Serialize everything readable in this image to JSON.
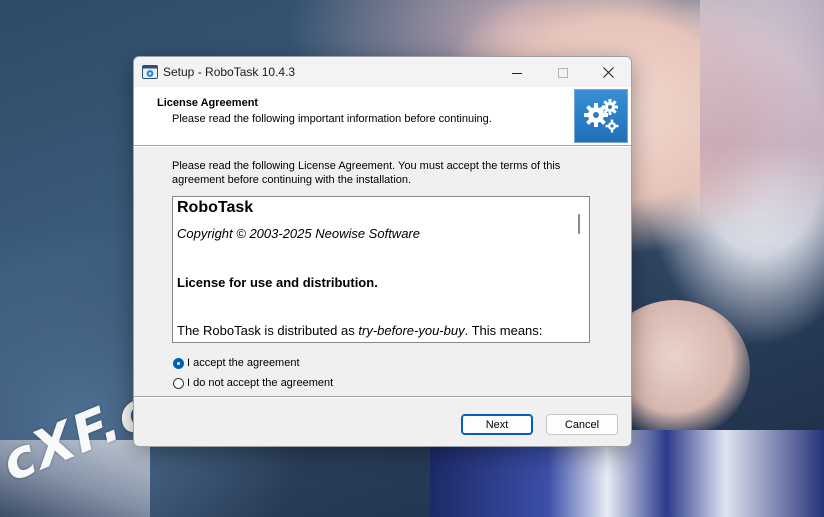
{
  "window": {
    "title": "Setup - RoboTask 10.4.3"
  },
  "header": {
    "title": "License Agreement",
    "subtitle": "Please read the following important information before continuing."
  },
  "intro_text": "Please read the following License Agreement. You must accept the terms of this agreement before continuing with the installation.",
  "license": {
    "product": "RoboTask",
    "copyright": "Copyright © 2003-2025 Neowise Software",
    "heading": "License for use and distribution.",
    "para_start": "The RoboTask is distributed as ",
    "para_em": "try-before-you-buy",
    "para_end": ". This means:"
  },
  "agreement": {
    "accept_label": "I accept the agreement",
    "decline_label": "I do not accept the agreement",
    "selected": "accept"
  },
  "buttons": {
    "next": "Next",
    "cancel": "Cancel"
  },
  "watermark": "cXF.co",
  "icons": {
    "app": "setup-app-icon",
    "header": "gears-icon",
    "minimize": "minimize-icon",
    "maximize": "maximize-icon",
    "close": "close-icon"
  },
  "colors": {
    "accent": "#005fb8",
    "header_image": "#2a7cc4"
  }
}
